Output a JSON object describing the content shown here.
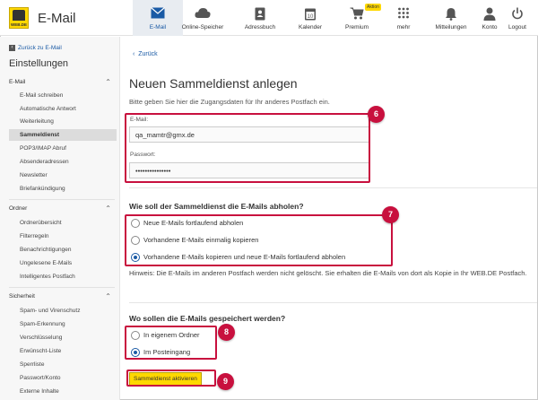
{
  "app": {
    "logo_text": "WEB.DE",
    "title": "E-Mail"
  },
  "nav": [
    {
      "label": "E-Mail",
      "icon": "envelope-icon",
      "active": true
    },
    {
      "label": "Online-Speicher",
      "icon": "cloud-icon"
    },
    {
      "label": "Adressbuch",
      "icon": "address-book-icon"
    },
    {
      "label": "Kalender",
      "icon": "calendar-icon",
      "day": "10"
    },
    {
      "label": "Premium",
      "icon": "cart-icon",
      "badge": "Aktion"
    },
    {
      "label": "mehr",
      "icon": "grid-icon"
    },
    {
      "label": "Mitteilungen",
      "icon": "bell-icon"
    },
    {
      "label": "Konto",
      "icon": "user-icon"
    },
    {
      "label": "Logout",
      "icon": "power-icon"
    }
  ],
  "sidebar": {
    "back_label": "Zurück zu E-Mail",
    "title": "Einstellungen",
    "groups": [
      {
        "label": "E-Mail",
        "items": [
          "E-Mail schreiben",
          "Automatische Antwort",
          "Weiterleitung",
          "Sammeldienst",
          "POP3/IMAP Abruf",
          "Absenderadressen",
          "Newsletter",
          "Briefankündigung"
        ]
      },
      {
        "label": "Ordner",
        "items": [
          "Ordnerübersicht",
          "Filterregeln",
          "Benachrichtigungen",
          "Ungelesene E-Mails",
          "Intelligentes Postfach"
        ]
      },
      {
        "label": "Sicherheit",
        "items": [
          "Spam- und Virenschutz",
          "Spam-Erkennung",
          "Verschlüsselung",
          "Erwünscht-Liste",
          "Sperrliste",
          "Passwort/Konto",
          "Externe Inhalte"
        ]
      }
    ],
    "active_item": "Sammeldienst"
  },
  "main": {
    "back_label": "Zurück",
    "title": "Neuen Sammeldienst anlegen",
    "subtitle": "Bitte geben Sie hier die Zugangsdaten für Ihr anderes Postfach ein.",
    "email_label": "E-Mail:",
    "email_value": "qa_mamtr@gmx.de",
    "password_label": "Passwort:",
    "password_value": "•••••••••••••••",
    "fetch_heading": "Wie soll der Sammeldienst die E-Mails abholen?",
    "fetch_options": [
      "Neue E-Mails fortlaufend abholen",
      "Vorhandene E-Mails einmalig kopieren",
      "Vorhandene E-Mails kopieren und neue E-Mails fortlaufend abholen"
    ],
    "fetch_selected": 2,
    "hint": "Hinweis: Die E-Mails im anderen Postfach werden nicht gelöscht. Sie erhalten die E-Mails von dort als Kopie in Ihr WEB.DE Postfach.",
    "store_heading": "Wo sollen die E-Mails gespeichert werden?",
    "store_options": [
      "In eigenem Ordner",
      "Im Posteingang"
    ],
    "store_selected": 1,
    "submit_label": "Sammeldienst aktivieren"
  },
  "annotations": [
    "6",
    "7",
    "8",
    "9"
  ],
  "colors": {
    "accent": "#1a5aa5",
    "brand_yellow": "#ffd800",
    "highlight": "#c8103e"
  }
}
